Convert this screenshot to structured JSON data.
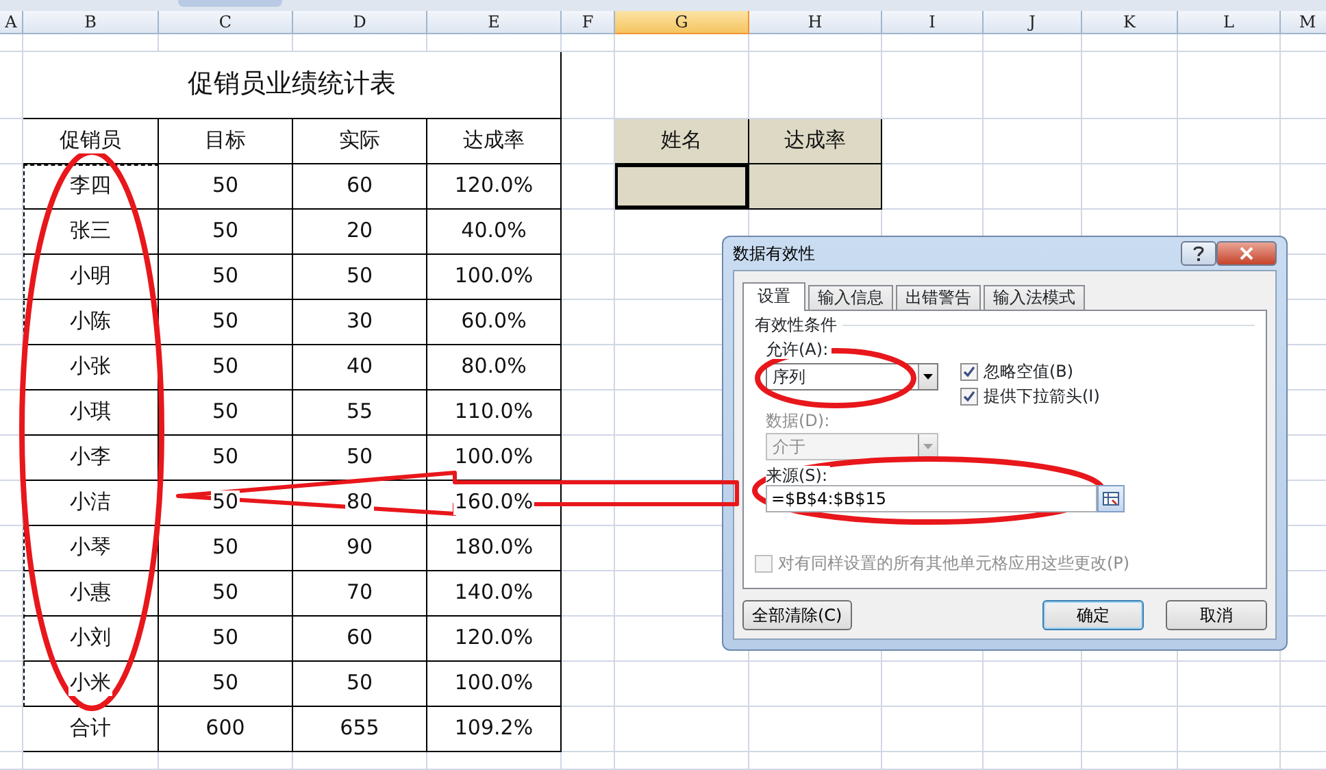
{
  "column_headers": [
    {
      "label": "A",
      "selected": false
    },
    {
      "label": "B",
      "selected": false
    },
    {
      "label": "C",
      "selected": false
    },
    {
      "label": "D",
      "selected": false
    },
    {
      "label": "E",
      "selected": false
    },
    {
      "label": "F",
      "selected": false
    },
    {
      "label": "G",
      "selected": true
    },
    {
      "label": "H",
      "selected": false
    },
    {
      "label": "I",
      "selected": false
    },
    {
      "label": "J",
      "selected": false
    },
    {
      "label": "K",
      "selected": false
    },
    {
      "label": "L",
      "selected": false
    },
    {
      "label": "M",
      "selected": false
    }
  ],
  "table": {
    "title": "促销员业绩统计表",
    "columns": [
      "促销员",
      "目标",
      "实际",
      "达成率"
    ],
    "rows": [
      [
        "李四",
        "50",
        "60",
        "120.0%"
      ],
      [
        "张三",
        "50",
        "20",
        "40.0%"
      ],
      [
        "小明",
        "50",
        "50",
        "100.0%"
      ],
      [
        "小陈",
        "50",
        "30",
        "60.0%"
      ],
      [
        "小张",
        "50",
        "40",
        "80.0%"
      ],
      [
        "小琪",
        "50",
        "55",
        "110.0%"
      ],
      [
        "小李",
        "50",
        "50",
        "100.0%"
      ],
      [
        "小洁",
        "50",
        "80",
        "160.0%"
      ],
      [
        "小琴",
        "50",
        "90",
        "180.0%"
      ],
      [
        "小惠",
        "50",
        "70",
        "140.0%"
      ],
      [
        "小刘",
        "50",
        "60",
        "120.0%"
      ],
      [
        "小米",
        "50",
        "50",
        "100.0%"
      ]
    ],
    "total": [
      "合计",
      "600",
      "655",
      "109.2%"
    ]
  },
  "lookup": {
    "columns": [
      "姓名",
      "达成率"
    ],
    "cells": [
      {
        "selected": true
      },
      {
        "selected": false
      }
    ]
  },
  "dialog": {
    "title": "数据有效性",
    "tabs": [
      {
        "label": "设置",
        "selected": true
      },
      {
        "label": "输入信息",
        "selected": false
      },
      {
        "label": "出错警告",
        "selected": false
      },
      {
        "label": "输入法模式",
        "selected": false
      }
    ],
    "group": "有效性条件",
    "allow": {
      "label": "允许(A):",
      "value": "序列"
    },
    "options": [
      {
        "label": "忽略空值(B)",
        "checked": true
      },
      {
        "label": "提供下拉箭头(I)",
        "checked": true
      }
    ],
    "data": {
      "label": "数据(D):",
      "value": "介于",
      "disabled": true
    },
    "source": {
      "label": "来源(S):",
      "value": "=$B$4:$B$15"
    },
    "apply_all": {
      "label": "对有同样设置的所有其他单元格应用这些更改(P)",
      "checked": false,
      "disabled": true
    },
    "buttons": [
      {
        "label": "全部清除(C)",
        "default": false
      },
      {
        "label": "确定",
        "default": true
      },
      {
        "label": "取消",
        "default": false
      }
    ]
  }
}
